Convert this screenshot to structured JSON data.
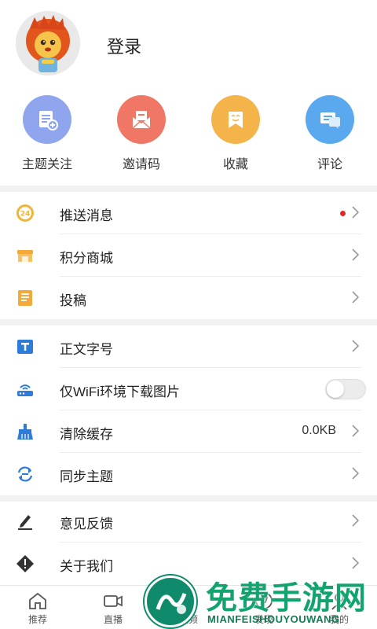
{
  "profile": {
    "login_label": "登录"
  },
  "quick_actions": [
    {
      "label": "主题关注",
      "icon": "topic-follow-icon",
      "color": "#8fa5ee"
    },
    {
      "label": "邀请码",
      "icon": "invite-mail-icon",
      "color": "#f07766"
    },
    {
      "label": "收藏",
      "icon": "favorite-icon",
      "color": "#f5b44a"
    },
    {
      "label": "评论",
      "icon": "comment-icon",
      "color": "#5aa9ee"
    }
  ],
  "menu": {
    "push": {
      "label": "推送消息",
      "icon": "push-24-icon",
      "badge": "24",
      "has_unread_dot": true
    },
    "points_mall": {
      "label": "积分商城",
      "icon": "store-icon"
    },
    "contribute": {
      "label": "投稿",
      "icon": "notebook-icon"
    },
    "font_size": {
      "label": "正文字号",
      "icon": "text-size-icon"
    },
    "wifi_images": {
      "label": "仅WiFi环境下载图片",
      "icon": "router-icon",
      "toggle_on": false
    },
    "clear_cache": {
      "label": "清除缓存",
      "icon": "broom-icon",
      "value": "0.0KB"
    },
    "sync_topics": {
      "label": "同步主题",
      "icon": "sync-icon"
    },
    "feedback": {
      "label": "意见反馈",
      "icon": "pen-icon"
    },
    "about": {
      "label": "关于我们",
      "icon": "info-diamond-icon"
    }
  },
  "tabbar": [
    {
      "label": "推荐",
      "icon": "home-icon"
    },
    {
      "label": "直播",
      "icon": "video-camera-icon"
    },
    {
      "label": "视频",
      "icon": "play-icon"
    },
    {
      "label": "发现",
      "icon": "discover-icon"
    },
    {
      "label": "我的",
      "icon": "user-icon"
    }
  ],
  "watermark": {
    "title": "免费手游网",
    "subtitle": "MIANFEISHOUYOUWANG"
  },
  "colors": {
    "accent_red": "#e4262b",
    "divider": "#ececec",
    "section_gap": "#f2f2f2"
  }
}
